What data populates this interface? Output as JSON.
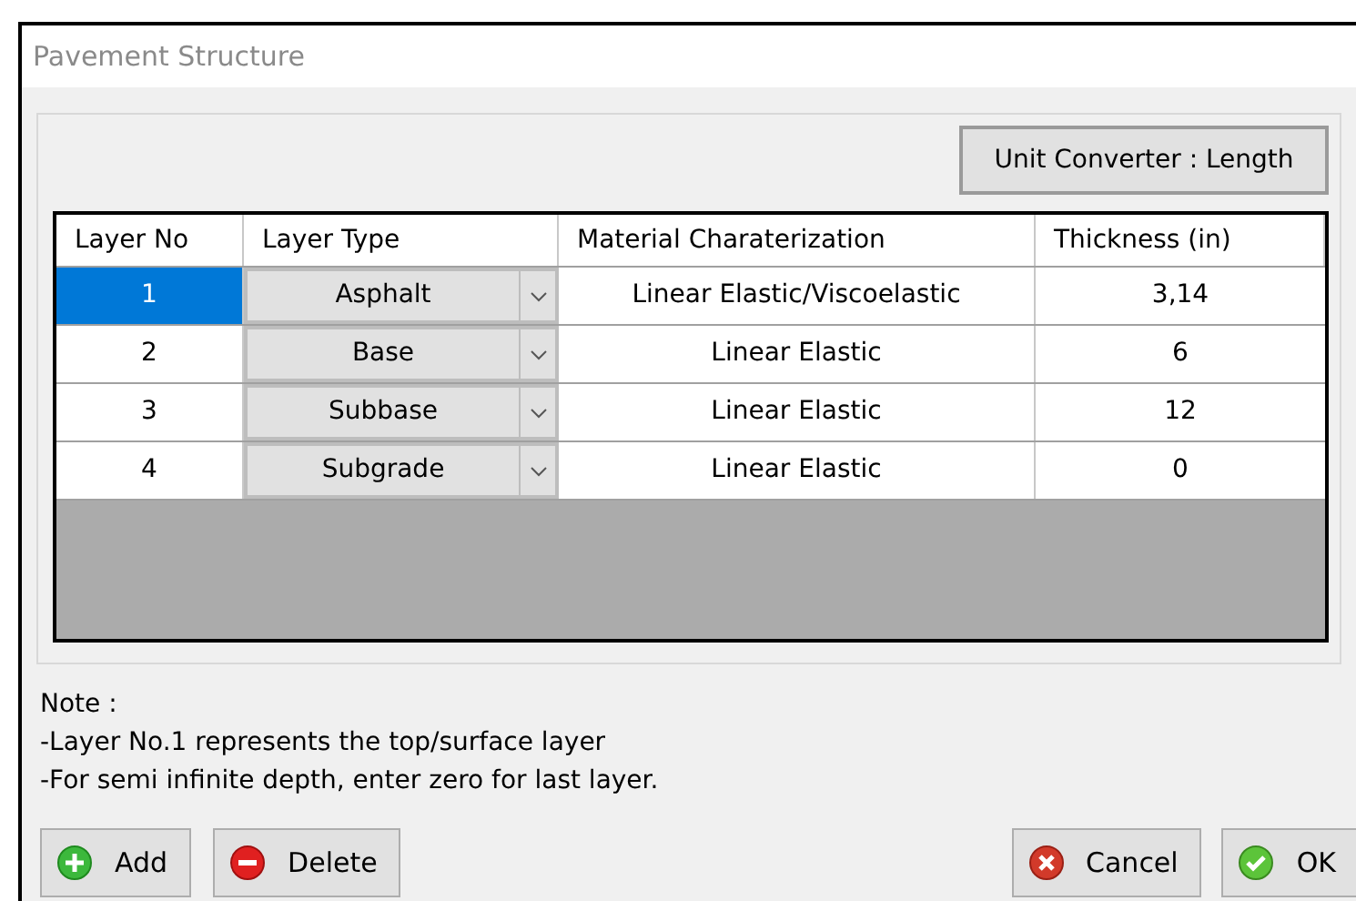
{
  "window": {
    "title": "Pavement Structure"
  },
  "unit_converter_button": "Unit Converter : Length",
  "table": {
    "columns": [
      "Layer No",
      "Layer Type",
      "Material Charaterization",
      "Thickness (in)"
    ],
    "rows": [
      {
        "layer_no": "1",
        "layer_type": "Asphalt",
        "material": "Linear Elastic/Viscoelastic",
        "thickness": "3,14",
        "selected": true
      },
      {
        "layer_no": "2",
        "layer_type": "Base",
        "material": "Linear Elastic",
        "thickness": "6",
        "selected": false
      },
      {
        "layer_no": "3",
        "layer_type": "Subbase",
        "material": "Linear Elastic",
        "thickness": "12",
        "selected": false
      },
      {
        "layer_no": "4",
        "layer_type": "Subgrade",
        "material": "Linear Elastic",
        "thickness": "0",
        "selected": false
      }
    ]
  },
  "note": {
    "title": "Note :",
    "lines": [
      "-Layer No.1 represents the top/surface layer",
      "-For semi infinite depth, enter zero for last layer."
    ]
  },
  "buttons": [
    {
      "kind": "add",
      "label": "Add"
    },
    {
      "kind": "delete",
      "label": "Delete"
    },
    {
      "kind": "cancel",
      "label": "Cancel"
    },
    {
      "kind": "ok",
      "label": "OK"
    }
  ]
}
